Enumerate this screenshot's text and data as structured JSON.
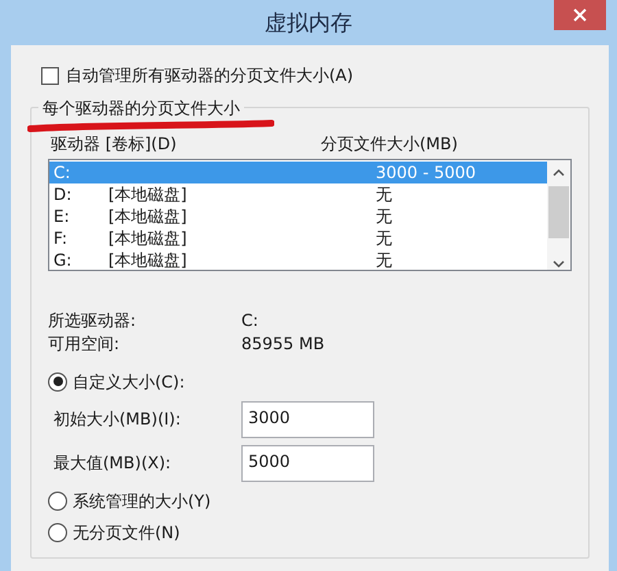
{
  "window": {
    "title": "虚拟内存"
  },
  "auto_manage": {
    "label": "自动管理所有驱动器的分页文件大小(A)",
    "checked": false
  },
  "group": {
    "label": "每个驱动器的分页文件大小",
    "underlined": true
  },
  "drive_list": {
    "columns": [
      "驱动器 [卷标](D)",
      "分页文件大小(MB)"
    ],
    "rows": [
      {
        "drive": "C:",
        "label": "",
        "size": "3000 - 5000",
        "selected": true
      },
      {
        "drive": "D:",
        "label": "[本地磁盘]",
        "size": "无",
        "selected": false
      },
      {
        "drive": "E:",
        "label": "[本地磁盘]",
        "size": "无",
        "selected": false
      },
      {
        "drive": "F:",
        "label": "[本地磁盘]",
        "size": "无",
        "selected": false
      },
      {
        "drive": "G:",
        "label": "[本地磁盘]",
        "size": "无",
        "selected": false
      }
    ]
  },
  "info": [
    {
      "label": "所选驱动器:",
      "value": "C:"
    },
    {
      "label": "可用空间:",
      "value": "85955 MB"
    }
  ],
  "options": [
    {
      "kind": "radio",
      "label": "自定义大小(C):",
      "selected": true
    },
    {
      "kind": "field",
      "label": "初始大小(MB)(I):",
      "value": "3000"
    },
    {
      "kind": "field",
      "label": "最大值(MB)(X):",
      "value": "5000"
    },
    {
      "kind": "radio",
      "label": "系统管理的大小(Y)",
      "selected": false
    },
    {
      "kind": "radio",
      "label": "无分页文件(N)",
      "selected": false
    }
  ]
}
